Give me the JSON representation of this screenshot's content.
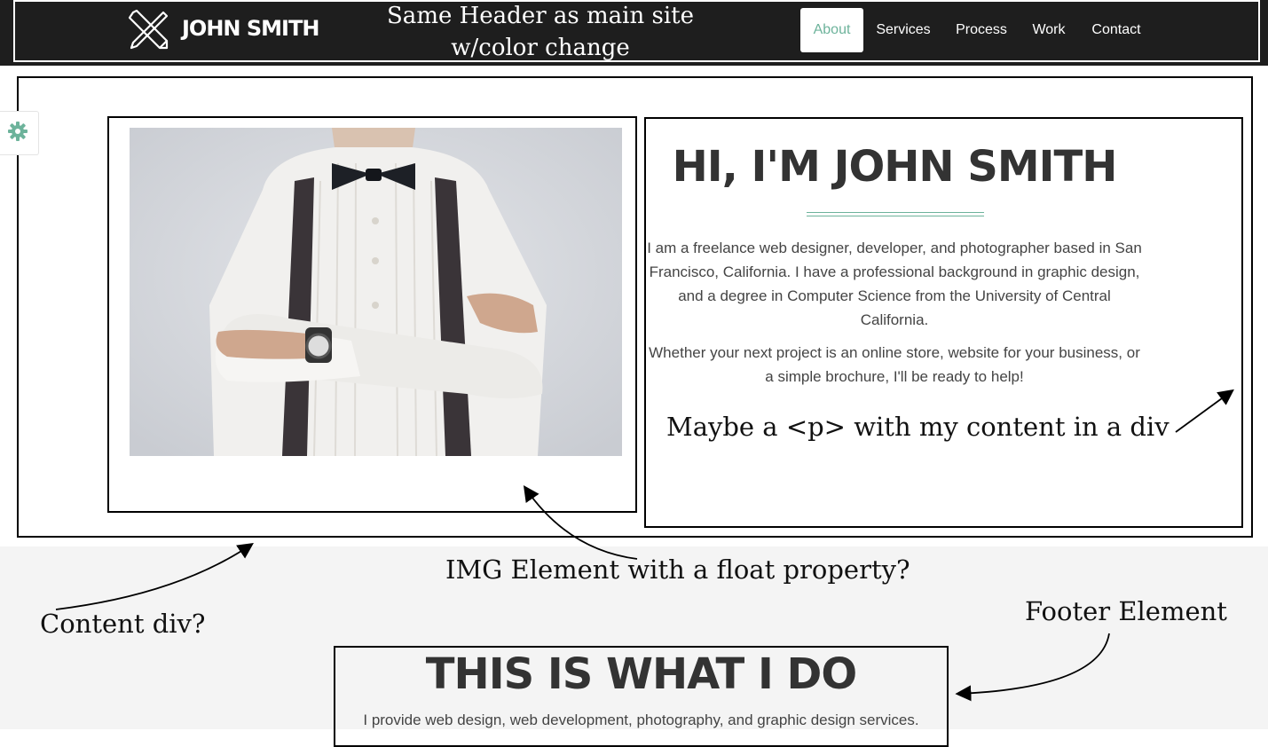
{
  "header": {
    "logo_text": "JOHN SMITH",
    "annotation": "Same Header as main site w/color change",
    "nav": [
      "About",
      "Services",
      "Process",
      "Work",
      "Contact"
    ],
    "active_nav": "About",
    "background_color": "#1e1e1e",
    "accent_color": "#6db39b"
  },
  "hero": {
    "title": "HI, I'M JOHN SMITH",
    "bio_paragraph_1": "I am a freelance web designer, developer, and photographer based in San Francisco, California. I have a professional background in graphic design, and a degree in Computer Science from the University of Central California.",
    "bio_paragraph_2": "Whether your next project is an online store, website for your business, or a simple brochure, I'll be ready to help!",
    "photo_icon": "man-with-crossed-arms-photo"
  },
  "annotations": {
    "paragraph_note": "Maybe a <p> with my content in a div",
    "image_note": "IMG Element with a float property?",
    "content_note": "Content div?",
    "footer_note": "Footer Element"
  },
  "footer": {
    "title": "THIS IS WHAT I DO",
    "text": "I provide web design, web development, photography, and graphic design services."
  },
  "settings_icon": "gear-icon"
}
